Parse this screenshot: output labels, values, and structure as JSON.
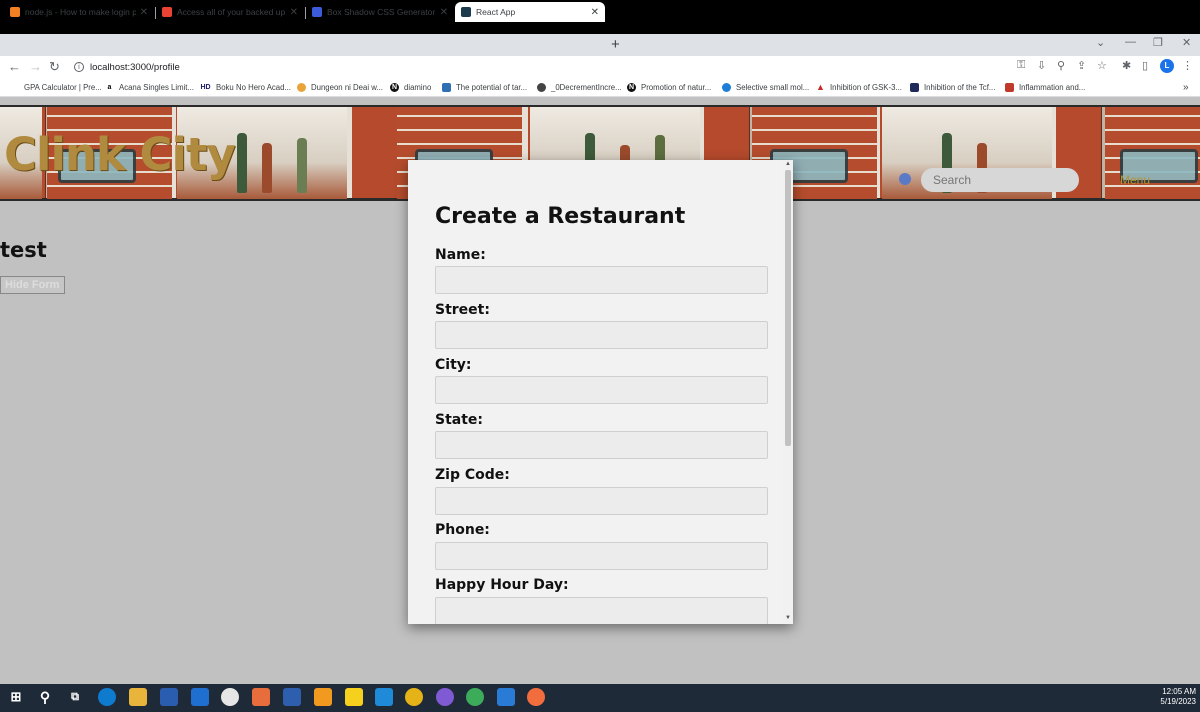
{
  "browser": {
    "tabs": [
      {
        "title": "node.js - How to make login pa",
        "active": false,
        "icon": "stackoverflow-icon",
        "color": "#f48024"
      },
      {
        "title": "Access all of your backed up pho",
        "active": false,
        "icon": "gmail-icon",
        "color": "#ea4335"
      },
      {
        "title": "Box Shadow CSS Generator | CSS",
        "active": false,
        "icon": "page-icon",
        "color": "#3b5bdb"
      },
      {
        "title": "React App",
        "active": true,
        "icon": "react-icon",
        "color": "#1b3a4b"
      }
    ],
    "url": "localhost:3000/profile",
    "profile_initial": "L",
    "bookmarks": [
      {
        "label": "GPA Calculator | Pre...",
        "icon": "none"
      },
      {
        "label": "Acana Singles Limit...",
        "icon": "amazon-icon"
      },
      {
        "label": "Boku No Hero Acad...",
        "icon": "hd-icon"
      },
      {
        "label": "Dungeon ni Deai w...",
        "icon": "site-icon"
      },
      {
        "label": "diamino",
        "icon": "notion-icon"
      },
      {
        "label": "The potential of tar...",
        "icon": "article-icon"
      },
      {
        "label": "_0DecrementIncre...",
        "icon": "github-icon"
      },
      {
        "label": "Promotion of natur...",
        "icon": "notion-icon"
      },
      {
        "label": "Selective small mol...",
        "icon": "link-icon"
      },
      {
        "label": "Inhibition of GSK-3...",
        "icon": "triangle-icon"
      },
      {
        "label": "Inhibition of the Tcf...",
        "icon": "arrow-icon"
      },
      {
        "label": "Inflammation and...",
        "icon": "shield-icon"
      }
    ]
  },
  "site": {
    "logo": "Clink City",
    "search_placeholder": "Search",
    "menu_label": "Menu",
    "page_title": "test",
    "hide_form_label": "Hide Form"
  },
  "modal": {
    "title": "Create a Restaurant",
    "fields": [
      {
        "label": "Name:",
        "value": ""
      },
      {
        "label": "Street:",
        "value": ""
      },
      {
        "label": "City:",
        "value": ""
      },
      {
        "label": "State:",
        "value": ""
      },
      {
        "label": "Zip Code:",
        "value": ""
      },
      {
        "label": "Phone:",
        "value": ""
      },
      {
        "label": "Happy Hour Day:",
        "value": ""
      }
    ]
  },
  "taskbar": {
    "time": "12:05 AM",
    "date": "5/19/2023"
  },
  "colors": {
    "page_bg": "#c1c1c1",
    "modal_bg": "#f2f2f2",
    "logo_gold": "#b08a3e",
    "menu_gold": "#b8912e"
  }
}
